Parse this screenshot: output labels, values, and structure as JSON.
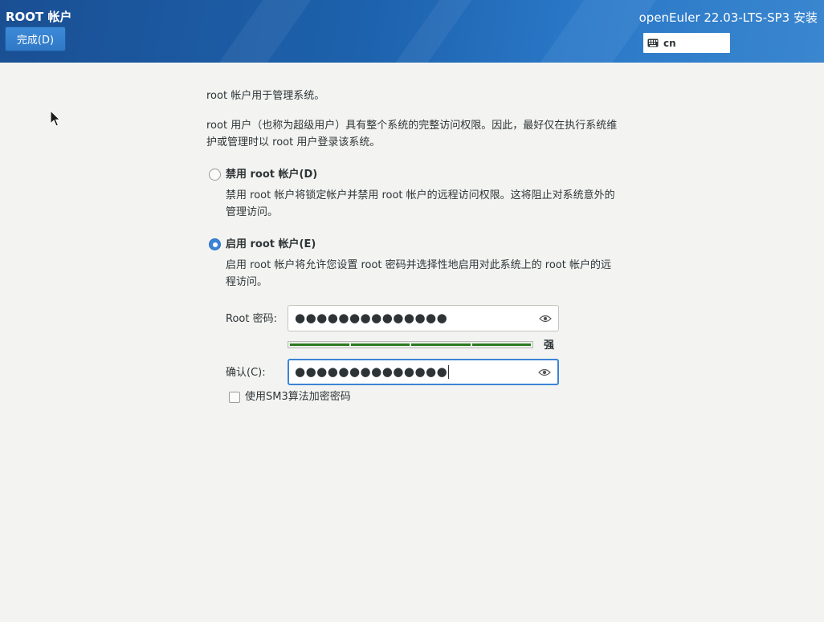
{
  "header": {
    "screen_title": "ROOT 帐户",
    "done_label": "完成(D)",
    "product_title": "openEuler 22.03-LTS-SP3 安装",
    "keyboard_layout": "cn"
  },
  "content": {
    "intro": "root 帐户用于管理系统。",
    "description": "root 用户（也称为超级用户）具有整个系统的完整访问权限。因此，最好仅在执行系统维护或管理时以 root 用户登录该系统。",
    "options": [
      {
        "label": "禁用 root 帐户(D)",
        "description": "禁用 root 帐户将锁定帐户并禁用 root 帐户的远程访问权限。这将阻止对系统意外的管理访问。",
        "selected": false
      },
      {
        "label": "启用 root 帐户(E)",
        "description": "启用 root 帐户将允许您设置 root 密码并选择性地启用对此系统上的 root 帐户的远程访问。",
        "selected": true
      }
    ],
    "password": {
      "label": "Root 密码:",
      "value": "●●●●●●●●●●●●●●",
      "strength_label": "强",
      "strength_fraction": 1.0
    },
    "confirm": {
      "label": "确认(C):",
      "value": "●●●●●●●●●●●●●●"
    },
    "sm3_checkbox": {
      "label": "使用SM3算法加密密码",
      "checked": false
    }
  },
  "colors": {
    "header_blue": "#1d62ad",
    "accent": "#3b84d6",
    "strength_green": "#2b7a1f"
  }
}
